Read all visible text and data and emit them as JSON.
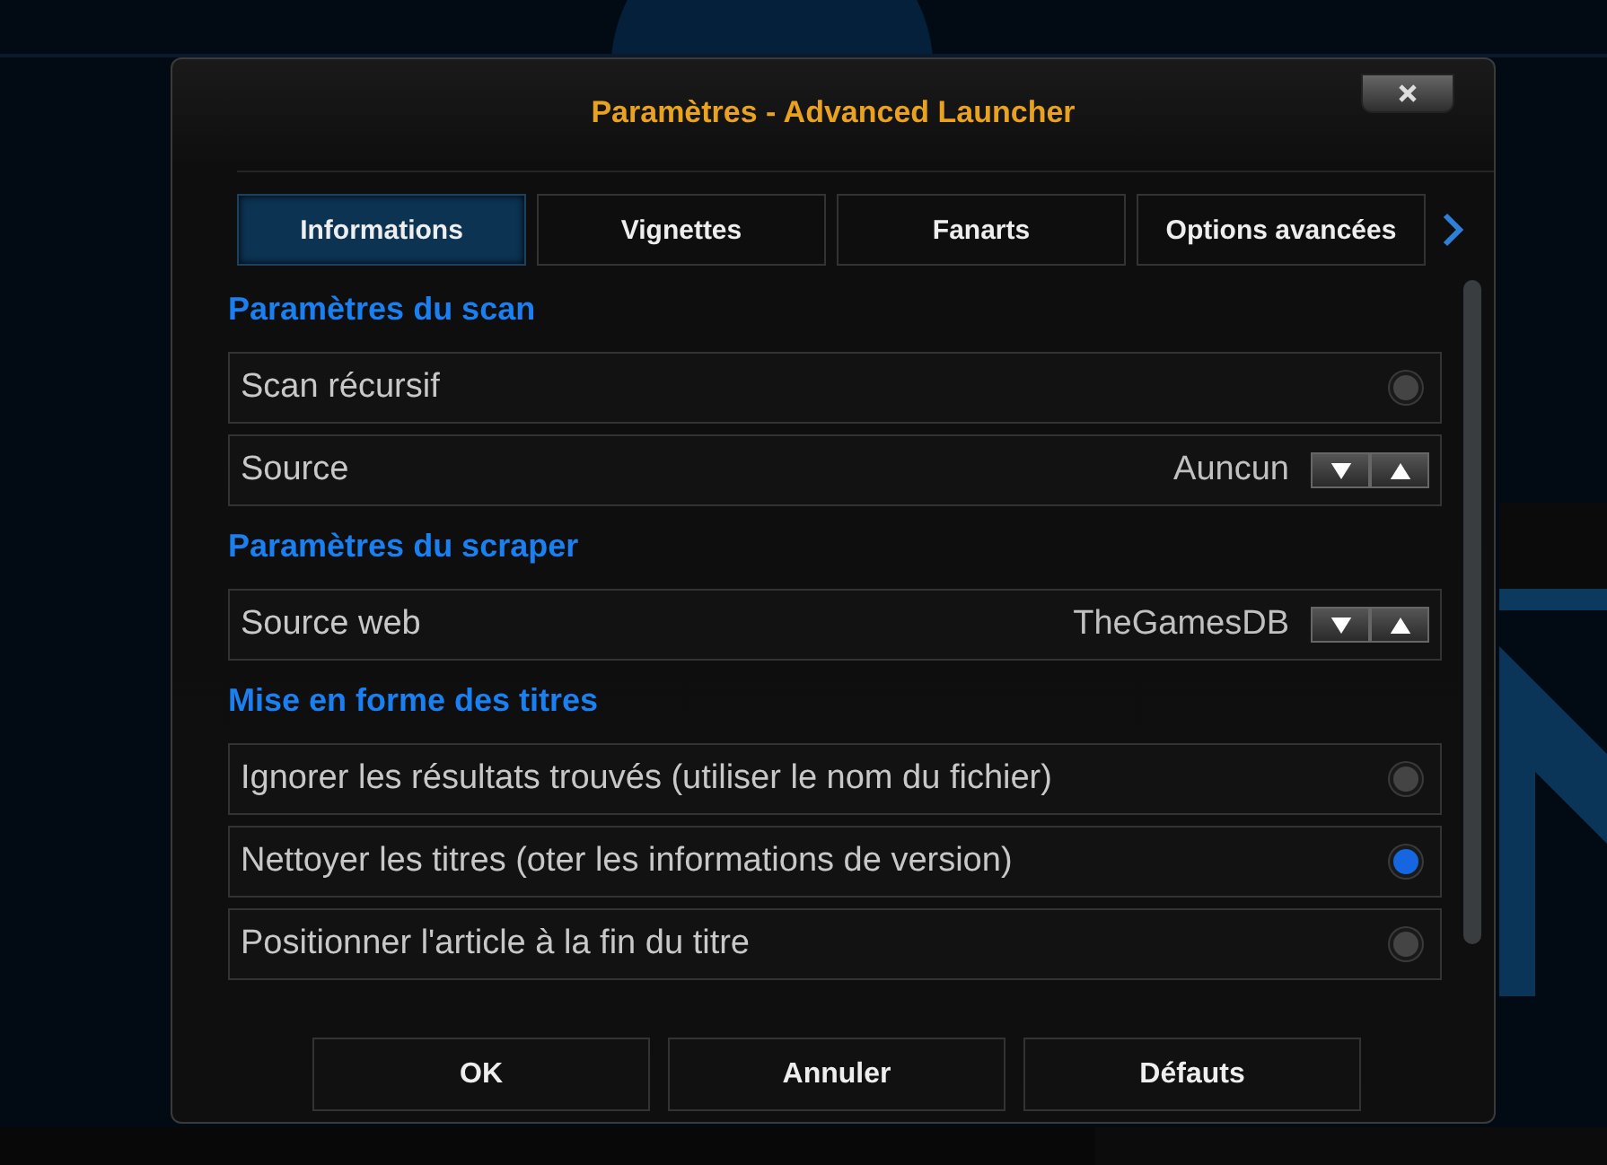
{
  "window": {
    "title": "Paramètres - Advanced Launcher"
  },
  "tabs": [
    {
      "label": "Informations",
      "selected": true
    },
    {
      "label": "Vignettes",
      "selected": false
    },
    {
      "label": "Fanarts",
      "selected": false
    },
    {
      "label": "Options avancées",
      "selected": false
    }
  ],
  "sections": [
    {
      "heading": "Paramètres du scan",
      "items": [
        {
          "kind": "toggle",
          "label": "Scan récursif",
          "on": false
        },
        {
          "kind": "spinner",
          "label": "Source",
          "value": "Auncun"
        }
      ]
    },
    {
      "heading": "Paramètres du scraper",
      "items": [
        {
          "kind": "spinner",
          "label": "Source web",
          "value": "TheGamesDB"
        }
      ]
    },
    {
      "heading": "Mise en forme des titres",
      "items": [
        {
          "kind": "toggle",
          "label": "Ignorer les résultats trouvés (utiliser le nom du fichier)",
          "on": false
        },
        {
          "kind": "toggle",
          "label": "Nettoyer les titres (oter les informations de version)",
          "on": true
        },
        {
          "kind": "toggle",
          "label": "Positionner l'article à la fin du titre",
          "on": false
        }
      ]
    }
  ],
  "buttons": [
    "OK",
    "Annuler",
    "Défauts"
  ]
}
